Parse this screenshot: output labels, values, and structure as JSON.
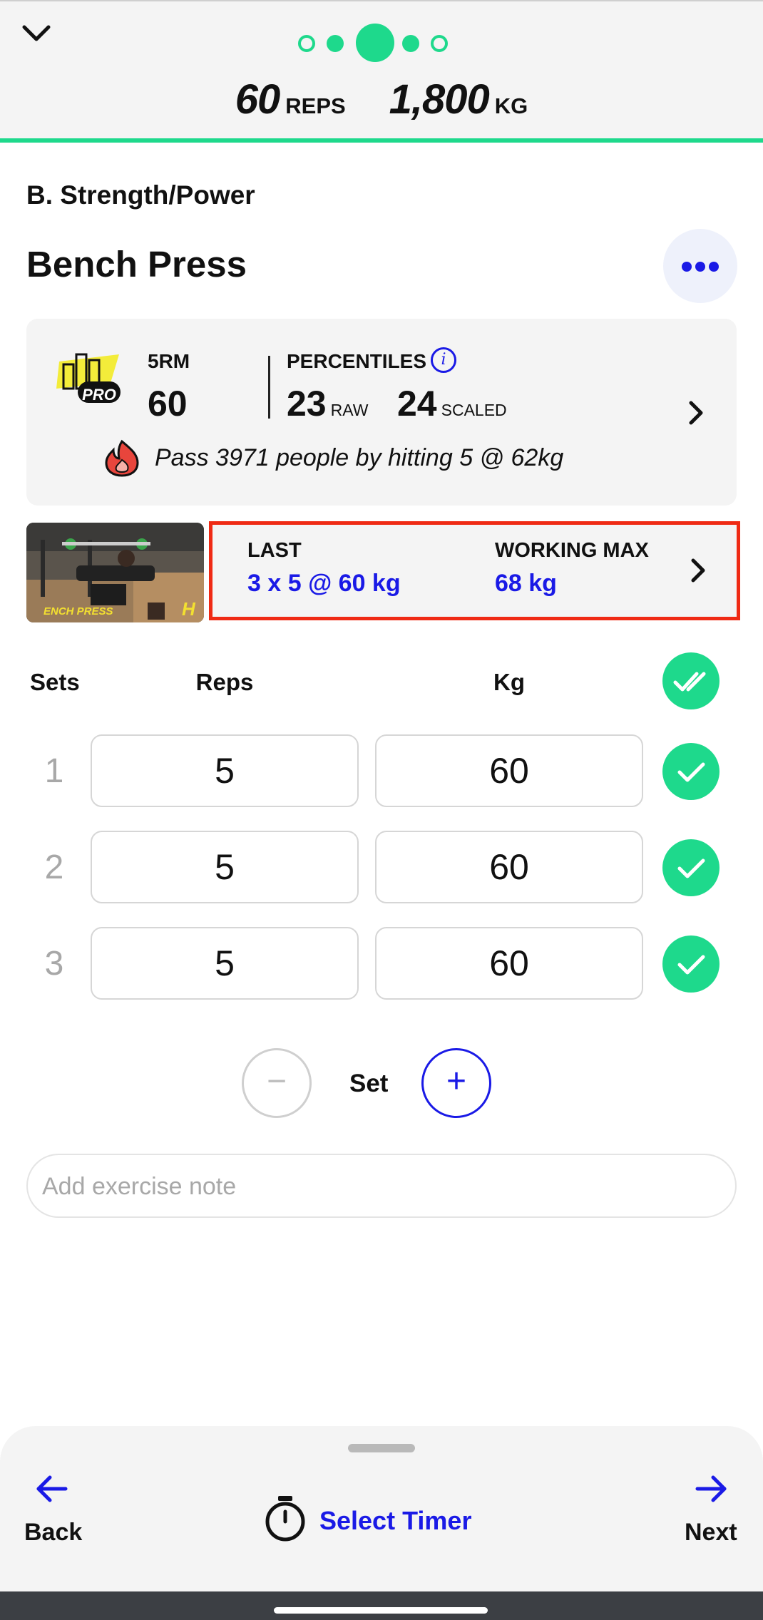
{
  "header": {
    "reps_value": "60",
    "reps_unit": "REPS",
    "weight_value": "1,800",
    "weight_unit": "KG",
    "accent_color": "#1ed98c"
  },
  "section_title": "B. Strength/Power",
  "exercise_name": "Bench Press",
  "stats": {
    "badge_text": "PRO",
    "rm_label": "5RM",
    "rm_value": "60",
    "percentiles_label": "PERCENTILES",
    "raw_value": "23",
    "raw_label": "RAW",
    "scaled_value": "24",
    "scaled_label": "SCALED",
    "pass_text": "Pass 3971 people by hitting 5 @ 62kg"
  },
  "history": {
    "thumbnail_caption": "ENCH PRESS",
    "thumbnail_logo": "H",
    "last_label": "LAST",
    "last_value": "3 x 5 @ 60 kg",
    "working_max_label": "WORKING MAX",
    "working_max_value": "68 kg"
  },
  "table": {
    "headers": {
      "sets": "Sets",
      "reps": "Reps",
      "kg": "Kg"
    },
    "rows": [
      {
        "set": "1",
        "reps": "5",
        "kg": "60",
        "done": true
      },
      {
        "set": "2",
        "reps": "5",
        "kg": "60",
        "done": true
      },
      {
        "set": "3",
        "reps": "5",
        "kg": "60",
        "done": true
      }
    ]
  },
  "set_control": {
    "minus": "−",
    "label": "Set",
    "plus": "+"
  },
  "note": {
    "placeholder": "Add exercise note"
  },
  "footer": {
    "back_label": "Back",
    "timer_label": "Select Timer",
    "next_label": "Next"
  },
  "colors": {
    "primary_blue": "#1a1ae6",
    "highlight_red": "#ef2a14",
    "green": "#1ed98c"
  }
}
